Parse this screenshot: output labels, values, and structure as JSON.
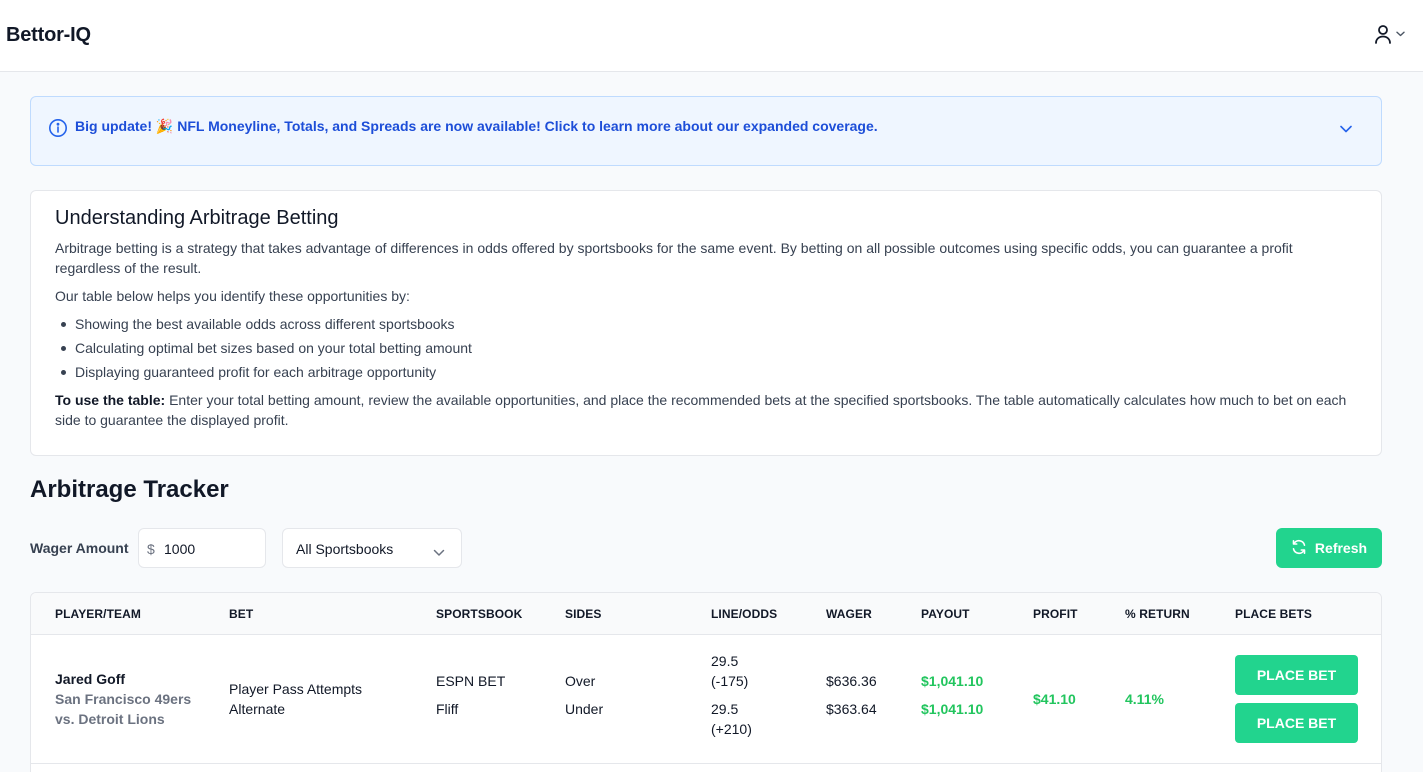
{
  "header": {
    "brand": "Bettor-IQ"
  },
  "banner": {
    "prefix": "Big update!",
    "emoji": "🎉",
    "message": "NFL Moneyline, Totals, and Spreads are now available! Click to learn more about our expanded coverage."
  },
  "explainer": {
    "title": "Understanding Arbitrage Betting",
    "intro": "Arbitrage betting is a strategy that takes advantage of differences in odds offered by sportsbooks for the same event. By betting on all possible outcomes using specific odds, you can guarantee a profit regardless of the result.",
    "lead": "Our table below helps you identify these opportunities by:",
    "bullets": [
      "Showing the best available odds across different sportsbooks",
      "Calculating optimal bet sizes based on your total betting amount",
      "Displaying guaranteed profit for each arbitrage opportunity"
    ],
    "usage_label": "To use the table:",
    "usage_text": "Enter your total betting amount, review the available opportunities, and place the recommended bets at the specified sportsbooks. The table automatically calculates how much to bet on each side to guarantee the displayed profit."
  },
  "tracker": {
    "title": "Arbitrage Tracker",
    "wager_label": "Wager Amount",
    "currency": "$",
    "wager_value": "1000",
    "sportsbook_filter": "All Sportsbooks",
    "refresh_label": "Refresh"
  },
  "table": {
    "columns": [
      "PLAYER/TEAM",
      "BET",
      "SPORTSBOOK",
      "SIDES",
      "LINE/ODDS",
      "WAGER",
      "PAYOUT",
      "PROFIT",
      "% RETURN",
      "PLACE BETS"
    ],
    "rows": [
      {
        "player": "Jared Goff",
        "matchup_line1": "San Francisco 49ers",
        "matchup_line2": "vs. Detroit Lions",
        "bet_line1": "Player Pass Attempts",
        "bet_line2": "Alternate",
        "legs": [
          {
            "sportsbook": "ESPN BET",
            "side": "Over",
            "line": "29.5",
            "odds": "(-175)",
            "wager": "$636.36",
            "payout": "$1,041.10",
            "button": "PLACE BET"
          },
          {
            "sportsbook": "Fliff",
            "side": "Under",
            "line": "29.5",
            "odds": "(+210)",
            "wager": "$363.64",
            "payout": "$1,041.10",
            "button": "PLACE BET"
          }
        ],
        "profit": "$41.10",
        "return_pct": "4.11%"
      }
    ]
  },
  "colors": {
    "accent": "#22d48e",
    "positive": "#22c55e",
    "banner_bg": "#eff6ff",
    "banner_text": "#1d4ed8"
  },
  "icons": {
    "user": "user-icon",
    "caret": "chevron-down-icon",
    "info": "info-icon",
    "refresh": "refresh-icon"
  }
}
